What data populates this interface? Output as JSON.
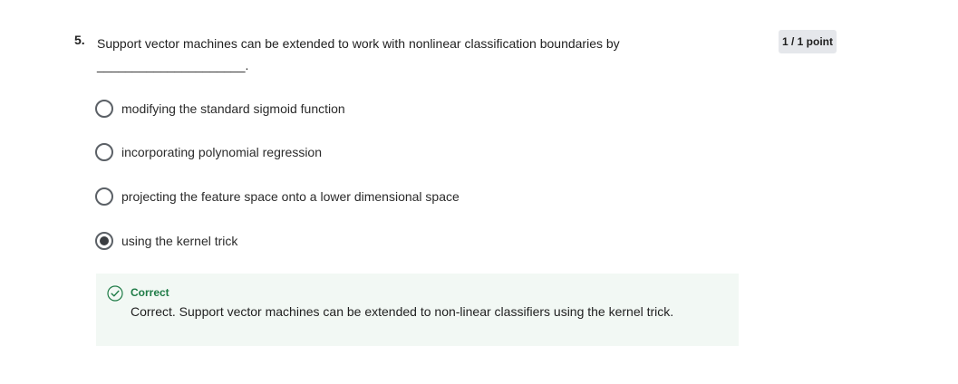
{
  "question": {
    "number": "5.",
    "text": "Support vector machines can be extended to work with nonlinear classification boundaries by _____________________.",
    "score": "1 / 1 point"
  },
  "options": [
    {
      "label": "modifying the standard sigmoid function",
      "selected": false
    },
    {
      "label": "incorporating polynomial regression",
      "selected": false
    },
    {
      "label": "projecting the feature space onto a lower dimensional space",
      "selected": false
    },
    {
      "label": "using the kernel trick",
      "selected": true
    }
  ],
  "feedback": {
    "title": "Correct",
    "text": "Correct. Support vector machines can be extended to non-linear classifiers using the kernel trick.",
    "color": "#1e7b46",
    "icon": "check-circle-icon"
  }
}
